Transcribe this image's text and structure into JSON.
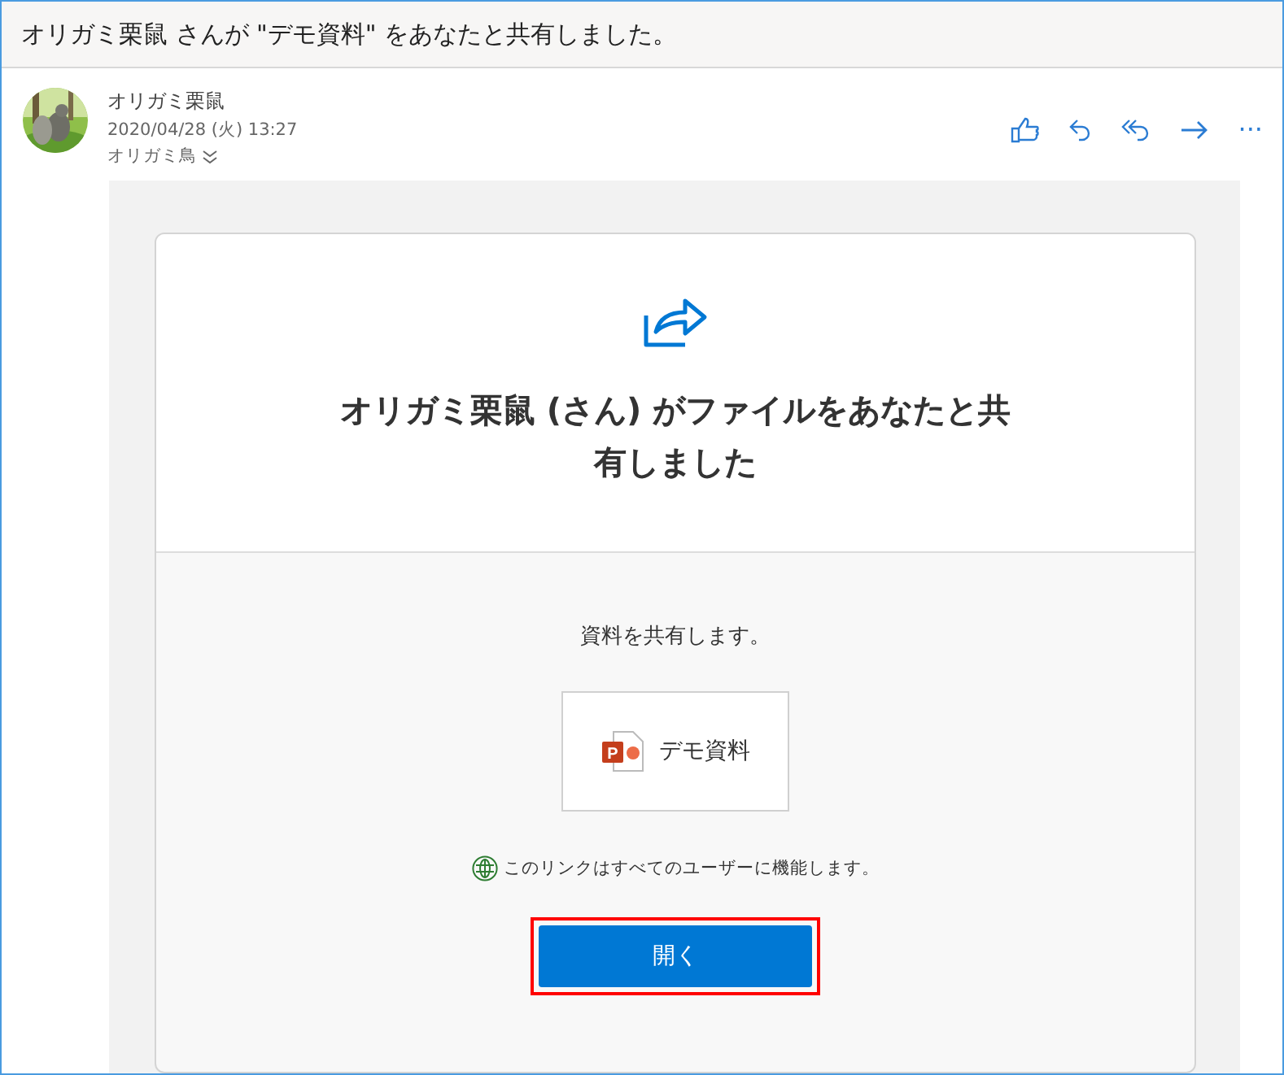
{
  "subject": "オリガミ栗鼠 さんが \"デモ資料\" をあなたと共有しました。",
  "message": {
    "sender": "オリガミ栗鼠",
    "date": "2020/04/28 (火) 13:27",
    "recipient": "オリガミ鳥",
    "more_label": "···"
  },
  "card": {
    "heading": "オリガミ栗鼠 (さん) がファイルをあなたと共有しました",
    "note": "資料を共有します。",
    "file": {
      "name": "デモ資料",
      "icon_letter": "P"
    },
    "link_info": "このリンクはすべてのユーザーに機能します。",
    "button": {
      "label": "開く",
      "highlighted": true
    }
  }
}
